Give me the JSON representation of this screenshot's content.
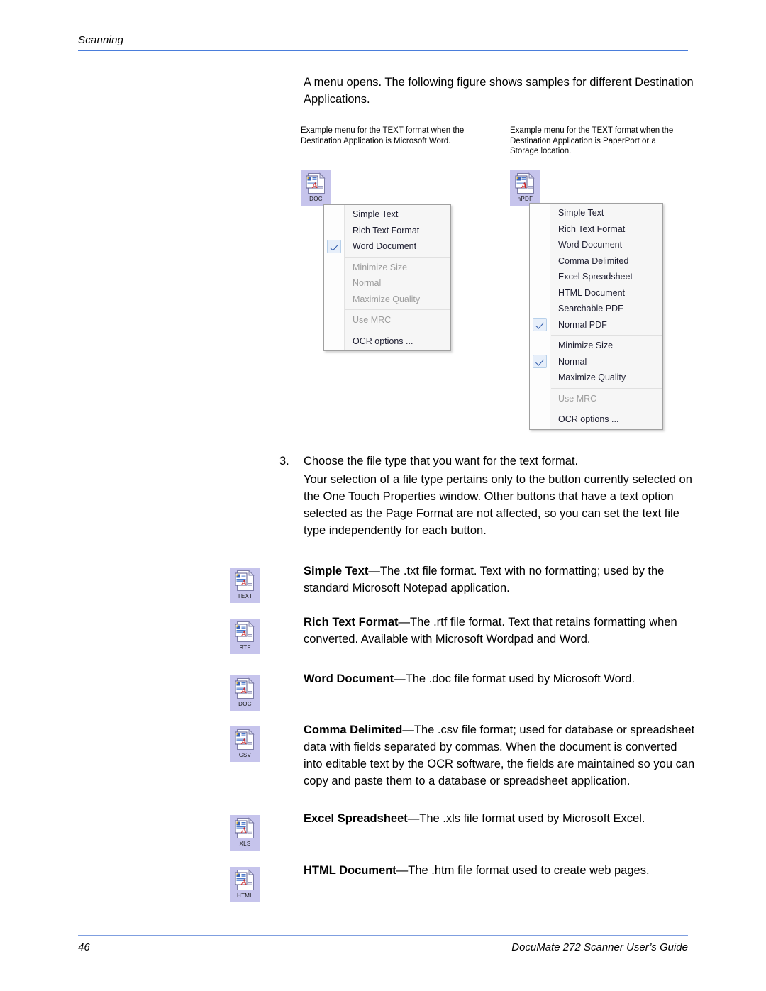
{
  "header": {
    "chapter": "Scanning",
    "rule_color": "#4a7ddb"
  },
  "intro": {
    "text": "A menu opens. The following figure shows samples for different Destination Applications."
  },
  "figure": {
    "caption_left": "Example menu for the TEXT format when the Destination Application is Microsoft Word.",
    "caption_right": "Example menu for the TEXT format when the Destination Application is PaperPort or a Storage location.",
    "icon_left_label": "DOC",
    "icon_right_label": "nPDF",
    "menu_left": {
      "groups": [
        [
          {
            "label": "Simple Text",
            "checked": false,
            "disabled": false
          },
          {
            "label": "Rich Text Format",
            "checked": false,
            "disabled": false
          },
          {
            "label": "Word Document",
            "checked": true,
            "disabled": false
          }
        ],
        [
          {
            "label": "Minimize Size",
            "checked": false,
            "disabled": true
          },
          {
            "label": "Normal",
            "checked": false,
            "disabled": true
          },
          {
            "label": "Maximize Quality",
            "checked": false,
            "disabled": true
          }
        ],
        [
          {
            "label": "Use MRC",
            "checked": false,
            "disabled": true
          }
        ],
        [
          {
            "label": "OCR options ...",
            "checked": false,
            "disabled": false
          }
        ]
      ]
    },
    "menu_right": {
      "groups": [
        [
          {
            "label": "Simple Text",
            "checked": false,
            "disabled": false
          },
          {
            "label": "Rich Text Format",
            "checked": false,
            "disabled": false
          },
          {
            "label": "Word Document",
            "checked": false,
            "disabled": false
          },
          {
            "label": "Comma Delimited",
            "checked": false,
            "disabled": false
          },
          {
            "label": "Excel Spreadsheet",
            "checked": false,
            "disabled": false
          },
          {
            "label": "HTML Document",
            "checked": false,
            "disabled": false
          },
          {
            "label": "Searchable PDF",
            "checked": false,
            "disabled": false
          },
          {
            "label": "Normal PDF",
            "checked": true,
            "disabled": false
          }
        ],
        [
          {
            "label": "Minimize Size",
            "checked": false,
            "disabled": false
          },
          {
            "label": "Normal",
            "checked": true,
            "disabled": false
          },
          {
            "label": "Maximize Quality",
            "checked": false,
            "disabled": false
          }
        ],
        [
          {
            "label": "Use MRC",
            "checked": false,
            "disabled": true
          }
        ],
        [
          {
            "label": "OCR options ...",
            "checked": false,
            "disabled": false
          }
        ]
      ]
    }
  },
  "step": {
    "number": "3.",
    "text": "Choose the file type that you want for the text format."
  },
  "note": {
    "text": "Your selection of a file type pertains only to the button currently selected on the One Touch Properties window. Other buttons that have a text option selected as the Page Format are not affected, so you can set the text file type independently for each button."
  },
  "definitions": [
    {
      "icon_label": "TEXT",
      "term": "Simple Text",
      "dash": "—",
      "description": "The .txt file format. Text with no formatting; used by the standard Microsoft Notepad application."
    },
    {
      "icon_label": "RTF",
      "term": "Rich Text Format",
      "dash": "—",
      "description": "The .rtf file format. Text that retains formatting when converted. Available with Microsoft Wordpad and Word."
    },
    {
      "icon_label": "DOC",
      "term": "Word Document",
      "dash": "—",
      "description": "The .doc file format used by Microsoft Word."
    },
    {
      "icon_label": "CSV",
      "term": "Comma Delimited",
      "dash": "—",
      "description": "The .csv file format; used for database or spreadsheet data with fields separated by commas. When the document is converted into editable text by the OCR software, the fields are maintained so you can copy and paste them to a database or spreadsheet application."
    },
    {
      "icon_label": "XLS",
      "term": "Excel Spreadsheet",
      "dash": "—",
      "description": "The .xls file format used by Microsoft Excel."
    },
    {
      "icon_label": "HTML",
      "term": "HTML Document",
      "dash": "—",
      "description": "The .htm file format used to create web pages."
    }
  ],
  "footer": {
    "page_number": "46",
    "guide_title": "DocuMate 272 Scanner User’s Guide",
    "rule_color": "#7f9fe0"
  }
}
